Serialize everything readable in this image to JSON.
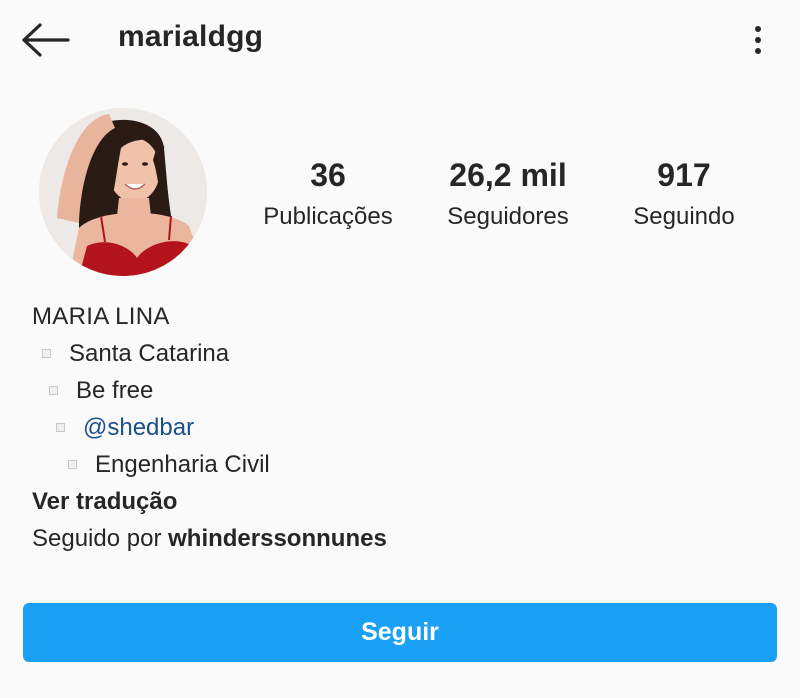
{
  "header": {
    "username": "marialdgg",
    "back_icon": "arrow-left-icon",
    "more_icon": "kebab-menu-icon"
  },
  "profile": {
    "avatar_icon": "profile-photo",
    "stats": [
      {
        "value": "36",
        "label": "Publicações"
      },
      {
        "value": "26,2 mil",
        "label": "Seguidores"
      },
      {
        "value": "917",
        "label": "Seguindo"
      }
    ]
  },
  "bio": {
    "name": "MARIA LINA",
    "lines": [
      "Santa Catarina",
      "Be free",
      "@shedbar",
      "Engenharia Civil"
    ],
    "translate_label": "Ver tradução",
    "followed_by_prefix": "Seguido por ",
    "followed_by_user": "whinderssonnunes"
  },
  "actions": {
    "follow_label": "Seguir"
  },
  "colors": {
    "background": "#fafafa",
    "follow_button": "#1aa0f5",
    "mention": "#1b4f8a",
    "text": "#262626"
  }
}
